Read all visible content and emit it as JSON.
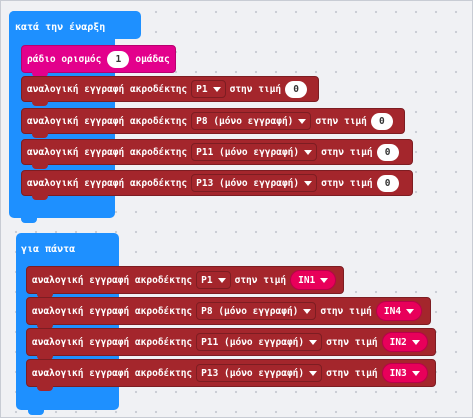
{
  "on_start": {
    "title": "κατά την έναρξη",
    "radio_block": {
      "prefix": "ράδιο ορισμός",
      "value": "1",
      "suffix": "ομάδας"
    },
    "writes": [
      {
        "label": "αναλογική εγγραφή ακροδέκτης",
        "pin": "P1",
        "mid": "στην τιμή",
        "value": "0"
      },
      {
        "label": "αναλογική εγγραφή ακροδέκτης",
        "pin": "P8 (μόνο εγγραφή)",
        "mid": "στην τιμή",
        "value": "0"
      },
      {
        "label": "αναλογική εγγραφή ακροδέκτης",
        "pin": "P11 (μόνο εγγραφή)",
        "mid": "στην τιμή",
        "value": "0"
      },
      {
        "label": "αναλογική εγγραφή ακροδέκτης",
        "pin": "P13 (μόνο εγγραφή)",
        "mid": "στην τιμή",
        "value": "0"
      }
    ]
  },
  "forever": {
    "title": "για πάντα",
    "writes": [
      {
        "label": "αναλογική εγγραφή ακροδέκτης",
        "pin": "P1",
        "mid": "στην τιμή",
        "value": "IN1"
      },
      {
        "label": "αναλογική εγγραφή ακροδέκτης",
        "pin": "P8 (μόνο εγγραφή)",
        "mid": "στην τιμή",
        "value": "IN4"
      },
      {
        "label": "αναλογική εγγραφή ακροδέκτης",
        "pin": "P11 (μόνο εγγραφή)",
        "mid": "στην τιμή",
        "value": "IN2"
      },
      {
        "label": "αναλογική εγγραφή ακροδέκτης",
        "pin": "P13 (μόνο εγγραφή)",
        "mid": "στην τιμή",
        "value": "IN3"
      }
    ]
  },
  "colors": {
    "event": "#1e90ff",
    "pins_block": "#a4262c",
    "radio_block": "#e3008c",
    "pin_reporter": "#e8005a"
  },
  "icons": [
    "dropdown-caret-icon"
  ]
}
